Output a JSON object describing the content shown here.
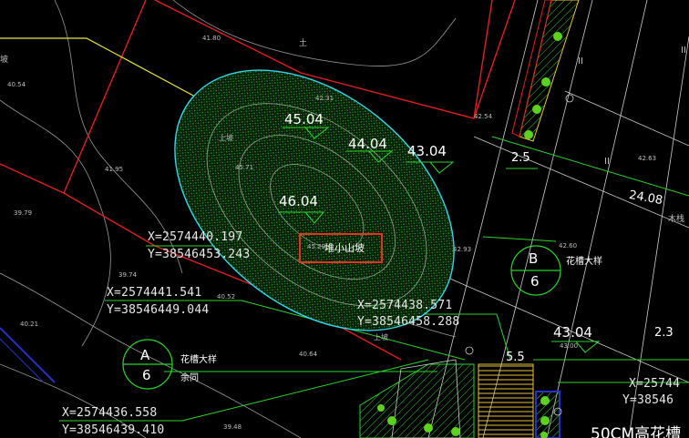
{
  "colors": {
    "background": "#000000",
    "boundary_red": "#e01f1f",
    "cyan_ellipse": "#35d6e6",
    "line_green": "#2ad42a",
    "yellow": "#e8e83a",
    "white_line": "#cfcfcf",
    "highlight_red": "#e53322",
    "blue": "#2432c8"
  },
  "elevations": {
    "e1": "45.04",
    "e2": "44.04",
    "e3": "43.04",
    "e4": "46.04",
    "e5": "43.04"
  },
  "coordinates": {
    "c1x": "X=2574440.197",
    "c1y": "Y=38546453.243",
    "c2x": "X=2574441.541",
    "c2y": "Y=38546449.044",
    "c3x": "X=2574438.571",
    "c3y": "Y=38546458.288",
    "c4x": "X=2574436.558",
    "c4y": "Y=38546439.410",
    "c5x": "X=25744",
    "c5y": "Y=38546"
  },
  "mound_label": "堆小山坡",
  "callouts": {
    "a_letter": "A",
    "a_number": "6",
    "a_title": "花槽大样",
    "a_note": "余同",
    "b_letter": "B",
    "b_number": "6",
    "b_title": "花槽大样"
  },
  "dimensions": {
    "d1": "2.5",
    "d2": "24.08",
    "d3": "5.5",
    "d4": "2.3"
  },
  "bottom_label": "50CM高花槽",
  "small_texts": {
    "s1": "41.80",
    "s2": "40.54",
    "s3": "41.95",
    "s4": "39.79",
    "s5": "39.74",
    "s6": "40.52",
    "s7": "40.21",
    "s8": "40.64",
    "s9": "39.48",
    "s10": "42.31",
    "s11": "42.54",
    "s12": "42.63",
    "s13": "42.60",
    "s14": "43.00",
    "s15": "42.93",
    "s16": "45.71",
    "s17": "45.29",
    "s18": "土",
    "s19": "上坡",
    "s20": "上坡",
    "s21": "坡",
    "s22": "木栈",
    "s23": "II",
    "s24": "II",
    "s25": "II"
  }
}
